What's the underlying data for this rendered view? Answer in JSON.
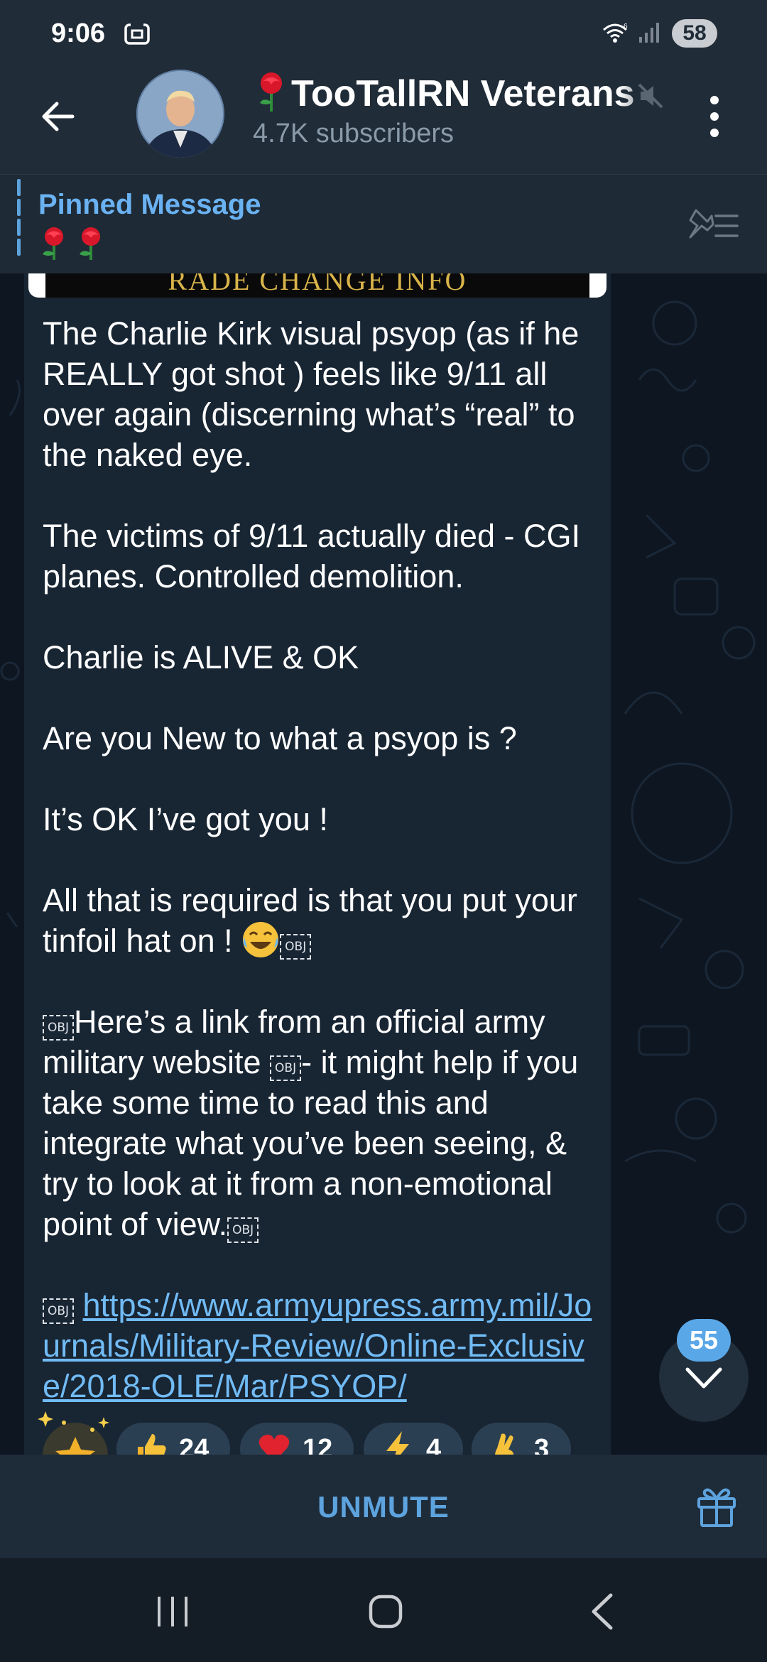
{
  "status_bar": {
    "time": "9:06",
    "battery": "58",
    "icons": [
      "screenshot-icon",
      "wifi-6-icon",
      "signal-icon",
      "battery-icon"
    ]
  },
  "header": {
    "title": "TooTallRN Veterans",
    "subtitle": "4.7K subscribers",
    "icons": [
      "back-arrow-icon",
      "rose-icon",
      "muted-icon",
      "more-vertical-icon"
    ]
  },
  "pinned": {
    "label": "Pinned Message",
    "preview_icons": [
      "rose-icon",
      "rose-icon"
    ],
    "action_icon": "pinned-list-icon"
  },
  "message": {
    "media_caption": "RADE CHANGE INFO",
    "obj_glyph": "OBJ",
    "p1": "The Charlie Kirk  visual psyop (as if he REALLY got shot ) feels like 9/11 all over again (discerning what’s “real” to the naked eye.",
    "p2": "The victims of 9/11 actually died - CGI planes. Controlled demolition.",
    "p3": "Charlie is ALIVE & OK",
    "p4": "Are you New to what a psyop is ?",
    "p5": "It’s OK I’ve got you !",
    "p6": "All that is required is that you put your tinfoil hat on ! ",
    "p7a": "Here’s a link from an official army military website ",
    "p7b": "- it might help if you take some time to read this and integrate what you’ve been seeing, & try to look at it from a non-emotional point of view.",
    "link": "https://www.armyupress.army.mil/Journals/Military-Review/Online-Exclusive/2018-OLE/Mar/PSYOP/"
  },
  "reactions": [
    {
      "icon": "star-sparkle-icon",
      "count": ""
    },
    {
      "icon": "thumbs-up-icon",
      "count": "24"
    },
    {
      "icon": "red-heart-icon",
      "count": "12"
    },
    {
      "icon": "lightning-icon",
      "count": "4"
    },
    {
      "icon": "crossed-fingers-icon",
      "count": "3"
    }
  ],
  "scroll": {
    "unread_count": "55"
  },
  "bottom": {
    "unmute_label": "UNMUTE",
    "gift_icon": "gift-icon"
  },
  "nav": [
    "recents-icon",
    "home-icon",
    "back-icon"
  ],
  "colors": {
    "accent": "#5da3de",
    "link": "#71bbf5",
    "bubble": "#182533",
    "header": "#202c38"
  }
}
